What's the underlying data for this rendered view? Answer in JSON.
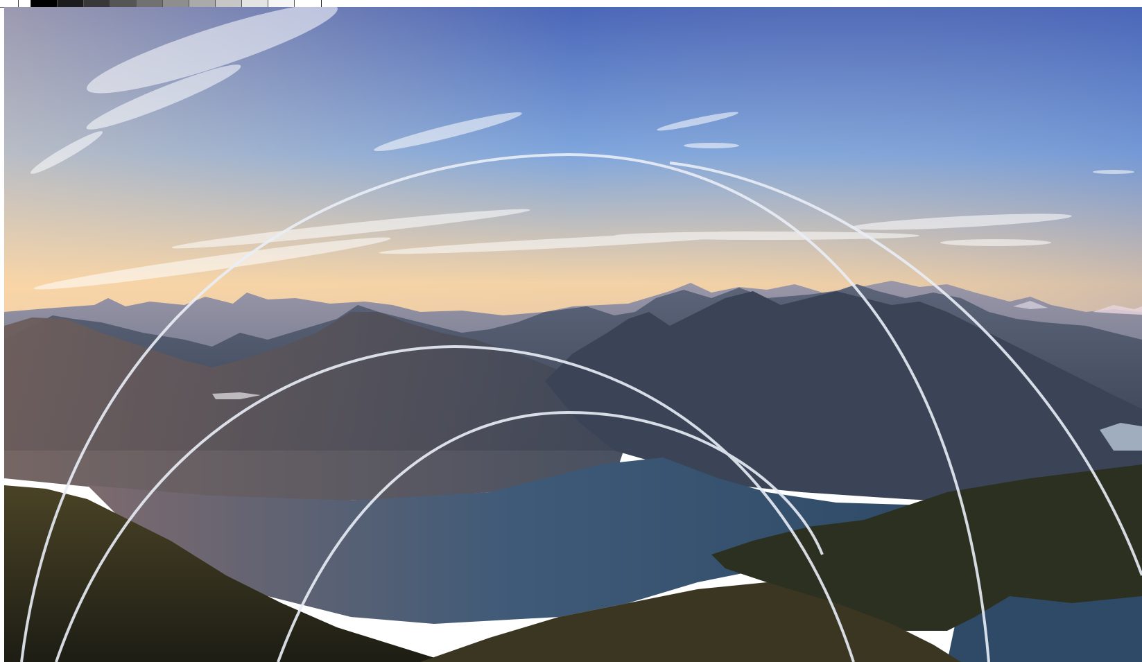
{
  "image": {
    "subject": "mountain-lake-landscape-at-dusk",
    "overlay": "concentric-arcs"
  },
  "swatches": [
    "#000000",
    "#1c1c1c",
    "#383838",
    "#555555",
    "#717171",
    "#8e8e8e",
    "#aaaaaa",
    "#c6c6c6",
    "#e3e3e3",
    "#f5f5f5",
    "#ffffff"
  ],
  "colors": {
    "sky_top": "#4a66b8",
    "sky_mid": "#7fa6dd",
    "horizon_glow": "#f3d2a6",
    "far_ridge": "#8a8ea6",
    "mid_ridge": "#525b72",
    "near_ridge": "#3a4456",
    "lake": "#3e5a78",
    "forest": "#2a2a1c",
    "arc_stroke": "#e9eef7"
  }
}
